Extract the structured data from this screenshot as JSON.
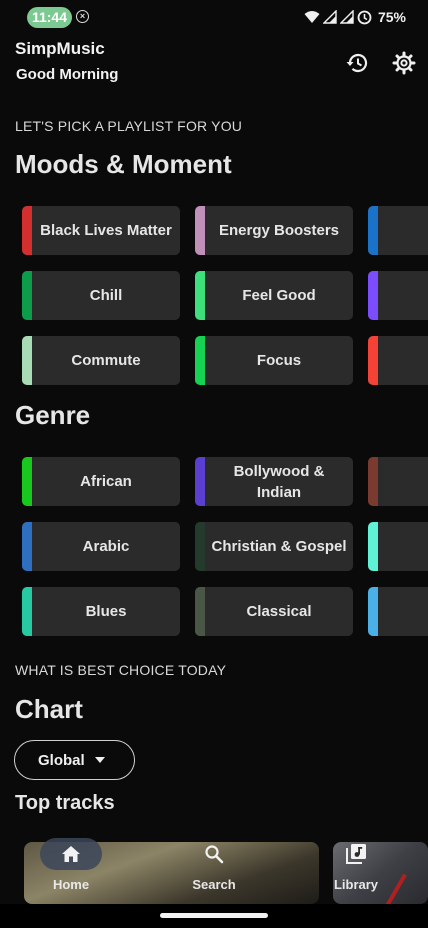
{
  "status": {
    "time": "11:44",
    "battery": "75%"
  },
  "header": {
    "app_title": "SimpMusic",
    "greeting": "Good Morning"
  },
  "moods": {
    "caption": "LET'S PICK A PLAYLIST FOR YOU",
    "title": "Moods & Moment",
    "items": [
      {
        "label": "Black Lives Matter",
        "color": "#d32f2f"
      },
      {
        "label": "Energy Boosters",
        "color": "#c090b8"
      },
      {
        "label": "",
        "color": "#1a73c8"
      },
      {
        "label": "Chill",
        "color": "#0d9d4a"
      },
      {
        "label": "Feel Good",
        "color": "#3de07a"
      },
      {
        "label": "",
        "color": "#7c4dff"
      },
      {
        "label": "Commute",
        "color": "#a8dcb4"
      },
      {
        "label": "Focus",
        "color": "#17d153"
      },
      {
        "label": "",
        "color": "#f44336"
      }
    ]
  },
  "genre": {
    "title": "Genre",
    "items": [
      {
        "label": "African",
        "color": "#19c81e"
      },
      {
        "label": "Bollywood & Indian",
        "color": "#5a3fd0"
      },
      {
        "label": "",
        "color": "#7a3a30"
      },
      {
        "label": "Arabic",
        "color": "#2e6fc0"
      },
      {
        "label": "Christian & Gospel",
        "color": "#243a2c"
      },
      {
        "label": "",
        "color": "#5ff2d6"
      },
      {
        "label": "Blues",
        "color": "#26c9a2"
      },
      {
        "label": "Classical",
        "color": "#4a5646"
      },
      {
        "label": "",
        "color": "#4ab0e6"
      }
    ]
  },
  "chart": {
    "caption": "WHAT IS BEST CHOICE TODAY",
    "title": "Chart",
    "region": "Global",
    "top_tracks": "Top tracks"
  },
  "nav": {
    "home": "Home",
    "search": "Search",
    "library": "Library"
  }
}
